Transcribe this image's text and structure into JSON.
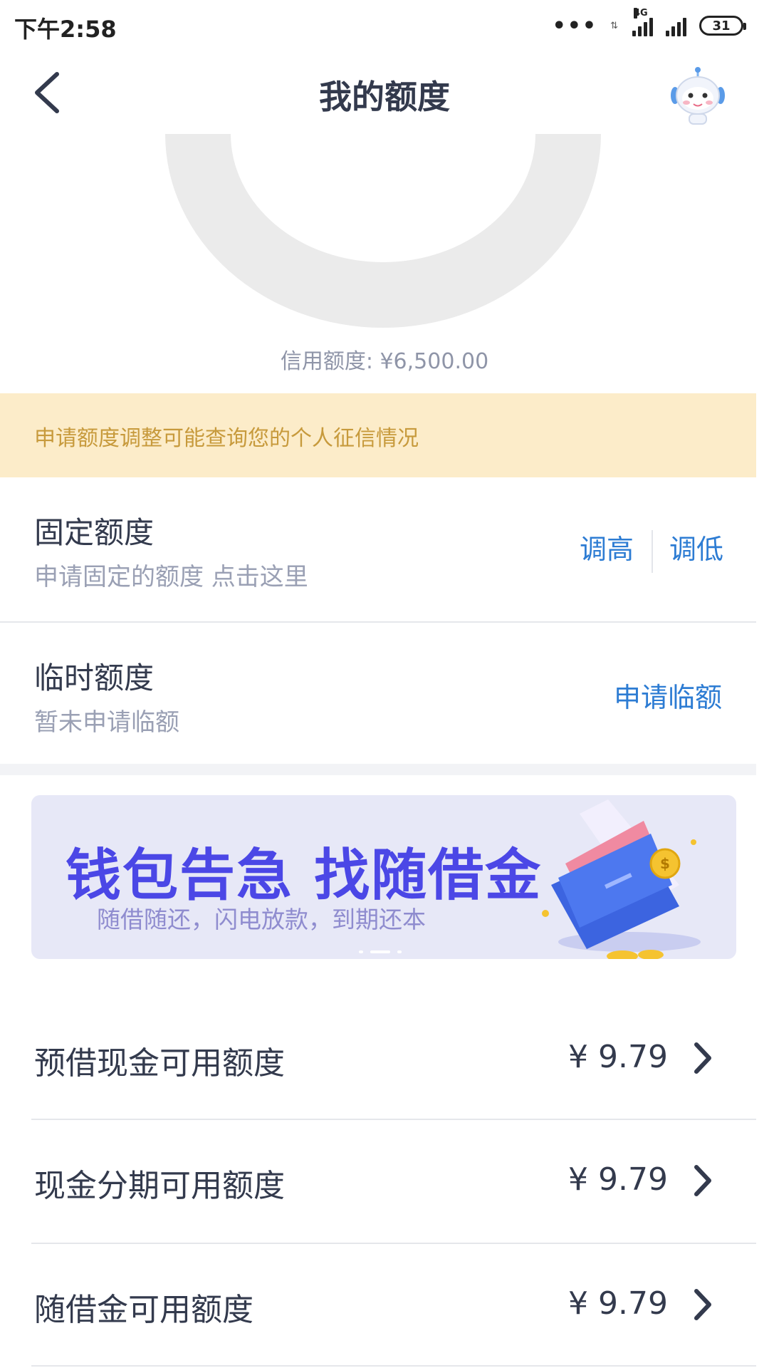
{
  "status_bar": {
    "time": "下午2:58",
    "dots": "•••",
    "network": "4G",
    "network_arrows": "⇅",
    "battery": "31"
  },
  "nav": {
    "title": "我的额度",
    "back_icon": "chevron-left-icon",
    "assistant_icon": "robot-avatar-icon"
  },
  "gauge": {
    "track_color": "#ebebeb",
    "credit_label": "信用额度: ¥6,500.00"
  },
  "notice": {
    "text": "申请额度调整可能查询您的个人征信情况",
    "bg": "#fcecc9",
    "color": "#c79a3c"
  },
  "fixed_quota": {
    "title": "固定额度",
    "subtitle": "申请固定的额度 点击这里",
    "raise": "调高",
    "lower": "调低"
  },
  "temp_quota": {
    "title": "临时额度",
    "subtitle": "暂未申请临额",
    "apply": "申请临额"
  },
  "banner": {
    "headline": "钱包告急 找随借金",
    "subline": "随借随还，闪电放款，到期还本",
    "active_dot": 1
  },
  "available": [
    {
      "label": "预借现金可用额度",
      "amount": "¥ 9.79"
    },
    {
      "label": "现金分期可用额度",
      "amount": "¥ 9.79"
    },
    {
      "label": "随借金可用额度",
      "amount": "¥ 9.79"
    }
  ],
  "colors": {
    "accent_blue": "#2d7cd3",
    "title_text": "#333a4d",
    "banner_headline": "#4b47e6"
  }
}
